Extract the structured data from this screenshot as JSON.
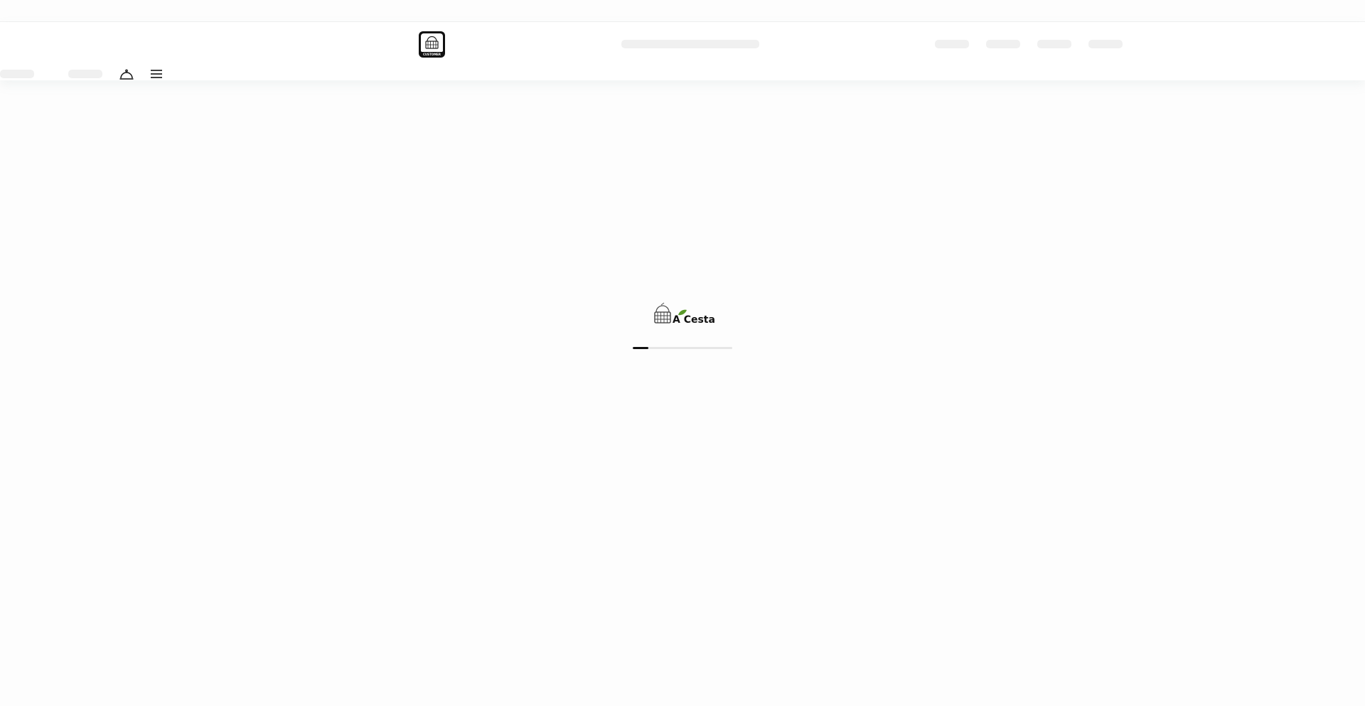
{
  "app": {
    "logo_alt": "A Cesta Customer",
    "logo_text": "A Cesta",
    "logo_subtext": "CUSTOMER"
  },
  "header": {
    "icons": {
      "service_bell": "service-bell-icon",
      "menu": "hamburger-menu-icon"
    }
  },
  "loading": {
    "brand_text": "A Cesta",
    "progress": 0.16,
    "colors": {
      "track": "#e6e6e6",
      "fill": "#111111",
      "leaf": "#5a9a2a"
    }
  }
}
